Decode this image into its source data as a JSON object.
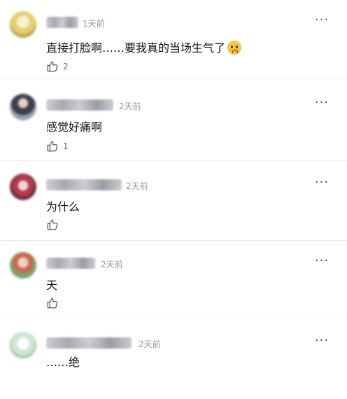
{
  "comments": [
    {
      "time": "1天前",
      "text": "直接打脸啊……要我真的当场生气了",
      "emoji": "sad-face",
      "likes": "2",
      "avatar_color": "#e9d98a"
    },
    {
      "time": "2天前",
      "text": "感觉好痛啊",
      "likes": "1",
      "avatar_color": "#6b6e7a"
    },
    {
      "time": "2天前",
      "text": "为什么",
      "likes": "",
      "avatar_color": "#b23a4a"
    },
    {
      "time": "2天前",
      "text": "天",
      "likes": "",
      "avatar_color": "#7aa36a"
    },
    {
      "time": "2天前",
      "text": "……绝",
      "likes": "",
      "avatar_color": "#cfe6d0"
    }
  ],
  "more_label": "···"
}
